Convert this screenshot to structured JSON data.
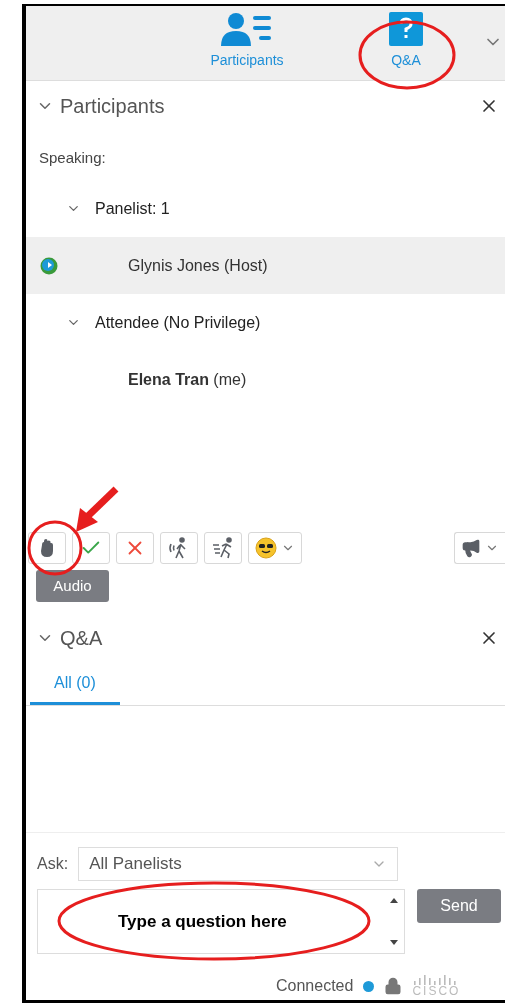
{
  "top_tabs": [
    {
      "label": "Participants",
      "kind": "people",
      "selected": false
    },
    {
      "label": "Q&A",
      "kind": "question",
      "selected": false
    }
  ],
  "participants": {
    "title": "Participants",
    "expanded": true,
    "speaking_label": "Speaking:",
    "groups": [
      {
        "label": "Panelist: 1",
        "expanded": true,
        "children": [
          {
            "name": "Glynis Jones (Host)",
            "selected": true,
            "connected": true
          }
        ]
      },
      {
        "label": "Attendee (No Privilege)",
        "expanded": true,
        "children": [
          {
            "name": "**Elena Tran** (me)",
            "selected": false
          }
        ]
      }
    ],
    "toolbar": [
      {
        "kind": "hand"
      },
      {
        "kind": "check"
      },
      {
        "kind": "cross"
      },
      {
        "kind": "walk"
      },
      {
        "kind": "run"
      },
      {
        "kind": "emoji"
      },
      {
        "kind": "megaphone"
      }
    ],
    "tooltip": "Audio"
  },
  "qa": {
    "title": "Q&A",
    "expanded": true,
    "tabs": [
      {
        "label": "All (0)",
        "selected": true
      }
    ],
    "ask_label": "Ask:",
    "ask_value": "All Panelists",
    "question_text": "Type a question here",
    "send": "Send"
  },
  "status_bar": {
    "text": "Connected",
    "logo": "CISCO"
  }
}
